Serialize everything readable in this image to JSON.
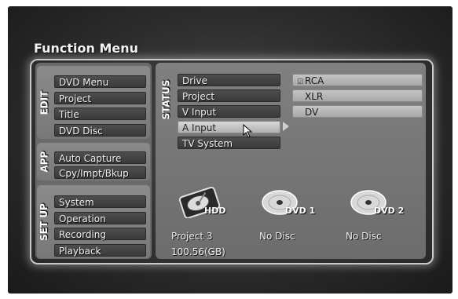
{
  "header": {
    "title": "Function Menu"
  },
  "edit_group": {
    "label": "EDIT",
    "items": [
      {
        "label": "DVD Menu"
      },
      {
        "label": "Project"
      },
      {
        "label": "Title"
      },
      {
        "label": "DVD Disc"
      }
    ]
  },
  "app_group": {
    "label": "APP",
    "items": [
      {
        "label": "Auto Capture"
      },
      {
        "label": "Cpy/Impt/Bkup"
      }
    ]
  },
  "setup_group": {
    "label": "SET UP",
    "items": [
      {
        "label": "System"
      },
      {
        "label": "Operation"
      },
      {
        "label": "Recording"
      },
      {
        "label": "Playback"
      }
    ]
  },
  "status": {
    "label": "STATUS",
    "items": [
      {
        "label": "Drive"
      },
      {
        "label": "Project"
      },
      {
        "label": "V Input"
      },
      {
        "label": "A Input",
        "selected": true
      },
      {
        "label": "TV System"
      }
    ],
    "options": [
      {
        "label": "RCA",
        "checked": true
      },
      {
        "label": "XLR"
      },
      {
        "label": "DV"
      }
    ]
  },
  "drives": [
    {
      "label": "HDD",
      "icon": "hdd-icon",
      "info_line1": "Project 3",
      "info_line2": "100.56(GB)"
    },
    {
      "label": "DVD 1",
      "icon": "dvd-disc-icon",
      "info_line1": "No Disc"
    },
    {
      "label": "DVD 2",
      "icon": "dvd-disc-icon",
      "info_line1": "No Disc"
    }
  ],
  "colors": {
    "background": "#2c2c2c",
    "button_dark": "#444444",
    "button_highlight": "#c8c8c8",
    "text": "#f0f0f0"
  }
}
